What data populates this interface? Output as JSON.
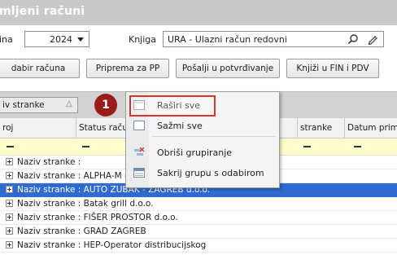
{
  "window": {
    "title": "mljeni računi"
  },
  "filters": {
    "year_label": "ina",
    "year_value": "2024",
    "book_label": "Knjiga",
    "book_value": "URA - Ulazni račun redovni"
  },
  "toolbar": {
    "buttons": [
      "dabir računa",
      "Priprema za PP",
      "Pošalji u potvrđivanje",
      "Knjiži u FIN i PDV"
    ]
  },
  "group_panel": {
    "group_by": "iv stranke",
    "sort_glyph": "△"
  },
  "columns": [
    "roj",
    "Status raču",
    "stranke",
    "Datum prim"
  ],
  "context_menu": {
    "items": [
      "Raširi sve",
      "Sažmi sve",
      "Obriši grupiranje",
      "Sakrij grupu s odabirom"
    ],
    "highlighted_index": 0
  },
  "badge": "1",
  "rows": [
    "Naziv stranke :",
    "Naziv stranke : ALPHA-M d.o.o.",
    "Naziv stranke : AUTO ZUBAK - ZAGREB d.o.o.",
    "Naziv stranke : Batak grill d.o.o.",
    "Naziv stranke : FIŠER PROSTOR d.o.o.",
    "Naziv stranke : GRAD ZAGREB",
    "Naziv stranke : HEP-Operator distribucijskog"
  ],
  "selected_row_index": 2,
  "colors": {
    "selection": "#2f6ad0",
    "highlight_border": "#d9332f",
    "badge": "#9b1b1b",
    "filter_row": "#ffffcc"
  }
}
